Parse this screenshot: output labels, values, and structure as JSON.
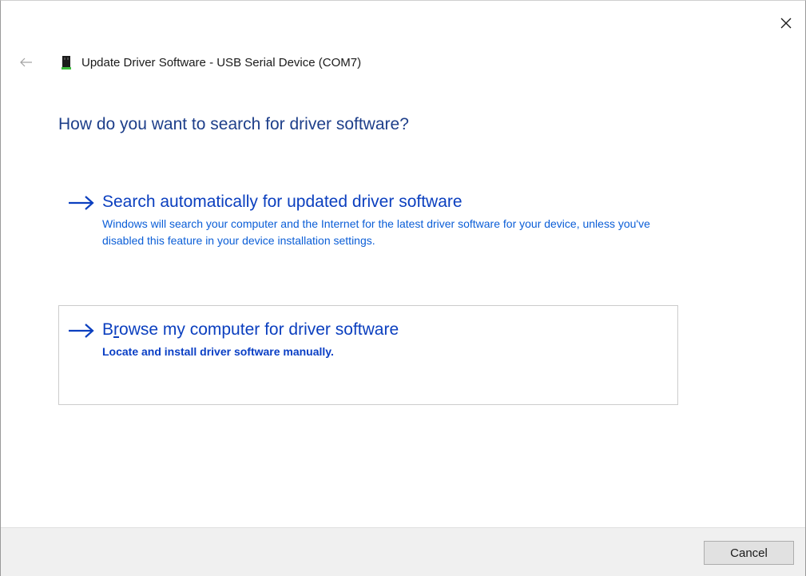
{
  "window": {
    "close_icon": "close-icon"
  },
  "header": {
    "back_icon": "back-arrow-icon",
    "device_icon": "usb-device-icon",
    "title": "Update Driver Software - USB Serial Device (COM7)"
  },
  "main": {
    "question": "How do you want to search for driver software?",
    "options": [
      {
        "icon": "arrow-right-icon",
        "title": "Search automatically for updated driver software",
        "description": "Windows will search your computer and the Internet for the latest driver software for your device, unless you've disabled this feature in your device installation settings."
      },
      {
        "icon": "arrow-right-icon",
        "title_prefix": "B",
        "title_access_key": "r",
        "title_rest": "owse my computer for driver software",
        "description": "Locate and install driver software manually."
      }
    ]
  },
  "footer": {
    "cancel_label": "Cancel"
  },
  "colors": {
    "link_blue": "#0b3fbf",
    "heading_blue": "#1e3f8a",
    "footer_bg": "#f0f0f0"
  }
}
